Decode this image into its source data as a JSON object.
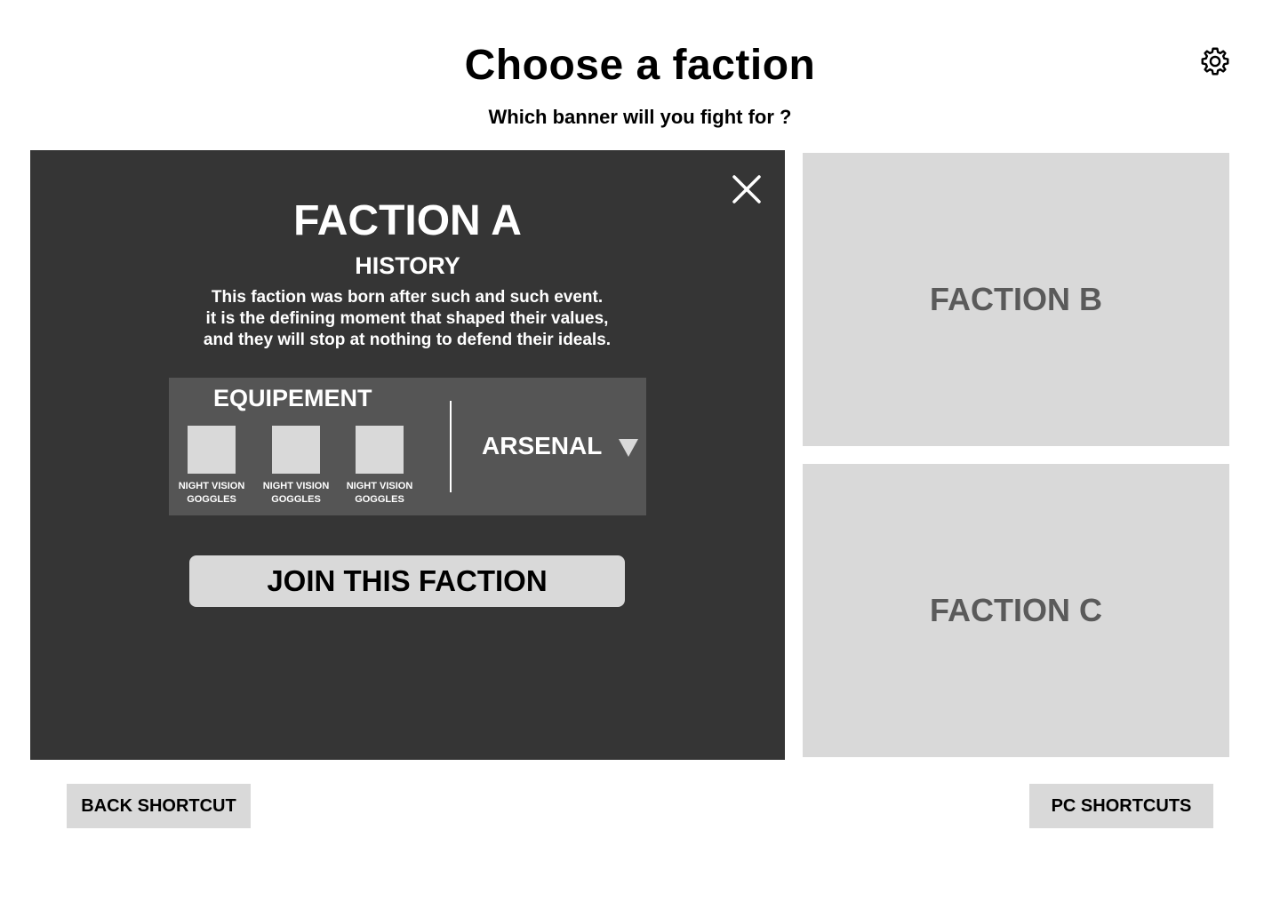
{
  "header": {
    "title": "Choose a faction",
    "subtitle": "Which banner will you fight for ?",
    "settings_icon": "gear-icon"
  },
  "selected_faction": {
    "name": "FACTION A",
    "close_icon": "close-icon",
    "history_heading": "HISTORY",
    "history_lines": [
      "This faction was born after such and such event.",
      "it is the defining moment that shaped their values,",
      "and they will stop at nothing to defend their ideals."
    ],
    "equipment": {
      "heading": "EQUIPEMENT",
      "items": [
        {
          "label_line1": "NIGHT VISION",
          "label_line2": "GOGGLES"
        },
        {
          "label_line1": "NIGHT VISION",
          "label_line2": "GOGGLES"
        },
        {
          "label_line1": "NIGHT VISION",
          "label_line2": "GOGGLES"
        }
      ],
      "arsenal_label": "ARSENAL",
      "arsenal_icon": "caret-down-icon"
    },
    "join_label": "JOIN THIS FACTION"
  },
  "other_factions": [
    {
      "name": "FACTION B"
    },
    {
      "name": "FACTION C"
    }
  ],
  "footer": {
    "back_label": "BACK SHORTCUT",
    "pc_label": "PC SHORTCUTS"
  },
  "colors": {
    "panel_background": "#353535",
    "equipment_background": "#555555",
    "card_background": "#d9d9d9",
    "card_text": "#5a5a5a",
    "page_background": "#ffffff"
  }
}
